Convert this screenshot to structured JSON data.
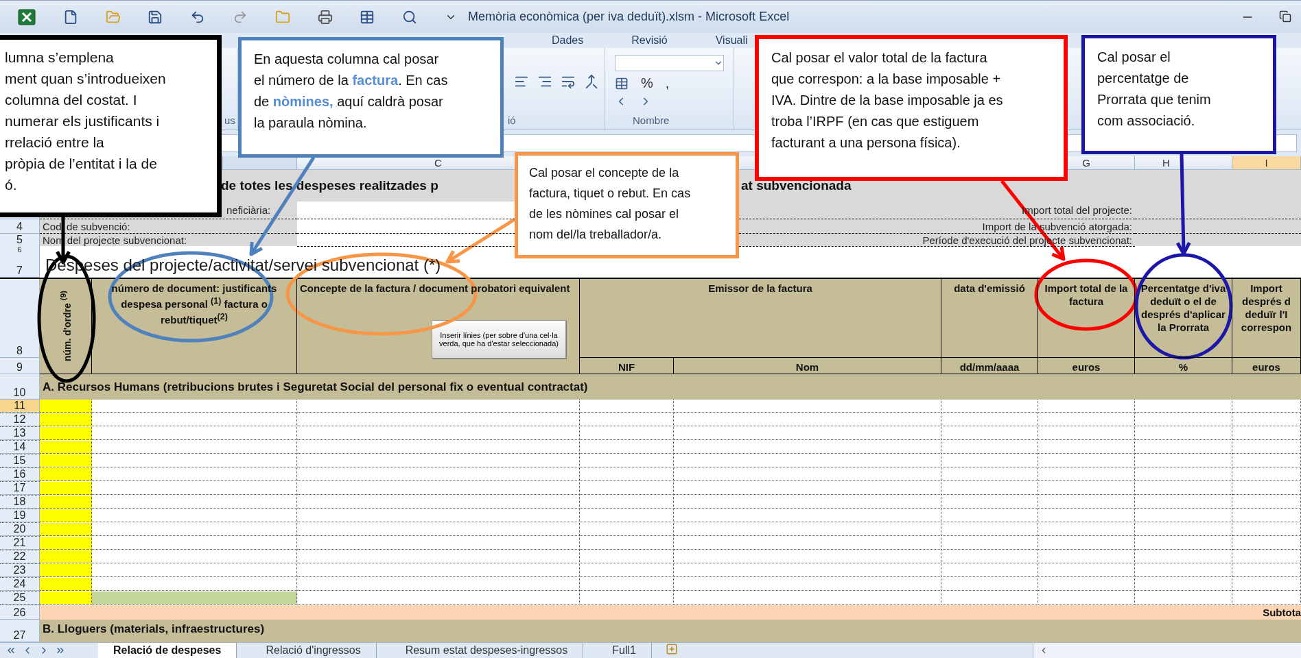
{
  "window": {
    "title": "Memòria econòmica (per iva deduït).xlsm  -  Microsoft Excel"
  },
  "ribbon": {
    "tabs": [
      {
        "label": "Dades",
        "selected": false
      },
      {
        "label": "Revisió",
        "selected": false
      },
      {
        "label": "Visuali",
        "selected": false
      }
    ],
    "group_labels": [
      "us",
      "ió",
      "Nombre"
    ],
    "number_buttons": [
      "%",
      ","
    ]
  },
  "column_headers": [
    {
      "letter": "C",
      "selected": false
    },
    {
      "letter": "G",
      "selected": false
    },
    {
      "letter": "H",
      "selected": false
    },
    {
      "letter": "I",
      "selected": true
    }
  ],
  "sheet": {
    "title_parts": [
      "de totes les despeses realitzades p",
      "at  subvencionada"
    ],
    "info_rows": [
      {
        "label": "neficiària:",
        "right": "Import total del projecte:"
      },
      {
        "row": "4",
        "label": "Codi de subvenció:",
        "right": "Import de la subvenció atorgada:"
      },
      {
        "row": "5",
        "label": "Nom del projecte subvencionat:",
        "right": "Període d'execució del projecte subvencionat:"
      }
    ],
    "spacer_row": "6",
    "section_title": {
      "row": "7",
      "text": "Despeses del projecte/activitat/servei subvencionat (*)"
    },
    "header": {
      "rows": [
        "8",
        "9"
      ],
      "order": "núm. d'ordre $^{(9)}$",
      "document": "número de document: justificants despesa personal $^{(1)}$ factura o rebut/tiquet$^{(2)}$",
      "concept": "Concepte de la factura / document probatori equivalent",
      "insert_button": "Inserir línies (per sobre d'una cel·la verda, que ha d'estar seleccionada)",
      "issuer": "Emissor de la factura",
      "nif": "NIF",
      "name": "Nom",
      "date": "data d'emissió",
      "date_unit": "dd/mm/aaaa",
      "total": "Import total de la factura",
      "total_unit": "euros",
      "percent": "Percentatge d'iva deduït o el de després d'aplicar la Prorrata",
      "percent_unit": "%",
      "after_lines": [
        "Import",
        "després d",
        "deduïr l'I",
        "correspon"
      ],
      "after_unit": "euros"
    },
    "section_a": {
      "row": "10",
      "text": "A. Recursos Humans (retribucions brutes i Seguretat Social del personal fix o eventual contractat)"
    },
    "data_rows": [
      {
        "row": "11",
        "selected": true,
        "kind": "entry"
      },
      {
        "row": "12",
        "selected": false,
        "kind": "entry"
      },
      {
        "row": "13",
        "selected": false,
        "kind": "entry"
      },
      {
        "row": "14",
        "selected": false,
        "kind": "entry"
      },
      {
        "row": "15",
        "selected": false,
        "kind": "entry"
      },
      {
        "row": "16",
        "selected": false,
        "kind": "entry"
      },
      {
        "row": "17",
        "selected": false,
        "kind": "entry"
      },
      {
        "row": "18",
        "selected": false,
        "kind": "entry"
      },
      {
        "row": "19",
        "selected": false,
        "kind": "entry"
      },
      {
        "row": "20",
        "selected": false,
        "kind": "entry"
      },
      {
        "row": "21",
        "selected": false,
        "kind": "entry"
      },
      {
        "row": "22",
        "selected": false,
        "kind": "entry"
      },
      {
        "row": "23",
        "selected": false,
        "kind": "entry"
      },
      {
        "row": "24",
        "selected": false,
        "kind": "entry"
      },
      {
        "row": "25",
        "selected": false,
        "kind": "insert_marker"
      }
    ],
    "subtotal": {
      "row": "26",
      "label": "Subtota"
    },
    "section_b": {
      "row": "27",
      "text": "B. Lloguers (materials, infraestructures)"
    }
  },
  "sheet_tabs": [
    {
      "label": "Relació de despeses",
      "selected": true
    },
    {
      "label": "Relació d'ingressos",
      "selected": false
    },
    {
      "label": "Resum estat despeses-ingressos",
      "selected": false
    },
    {
      "label": "Full1",
      "selected": false
    }
  ],
  "callouts": [
    {
      "color": "#000000",
      "lines": [
        "lumna s’emplena",
        "ment quan s’introdueixen",
        "columna del costat. I",
        "numerar els justificants i",
        "rrelació entre la",
        "pròpia de l’entitat i la de",
        "ó."
      ]
    },
    {
      "color": "#4f81bd",
      "lines": [
        "En aquesta columna cal posar",
        "el número de la **factura**. En cas",
        "de **nòmines,** aquí caldrà posar",
        "la paraula nòmina."
      ]
    },
    {
      "color": "#f79646",
      "lines": [
        "Cal posar el concepte de la",
        "factura, tiquet o rebut. En cas",
        "de les nòmines cal posar el",
        "nom del/la  treballador/a."
      ]
    },
    {
      "color": "#ff0000",
      "lines": [
        "Cal posar el valor total de la factura",
        "que correspon: a la base imposable +",
        "IVA. Dintre de la base imposable ja es",
        "troba l’IRPF (en cas que estiguem",
        "facturant a una persona física)."
      ]
    },
    {
      "color": "#1c17a8",
      "lines": [
        "Cal posar el",
        "percentatge de",
        "Prorrata que tenim",
        "com associació."
      ]
    }
  ]
}
